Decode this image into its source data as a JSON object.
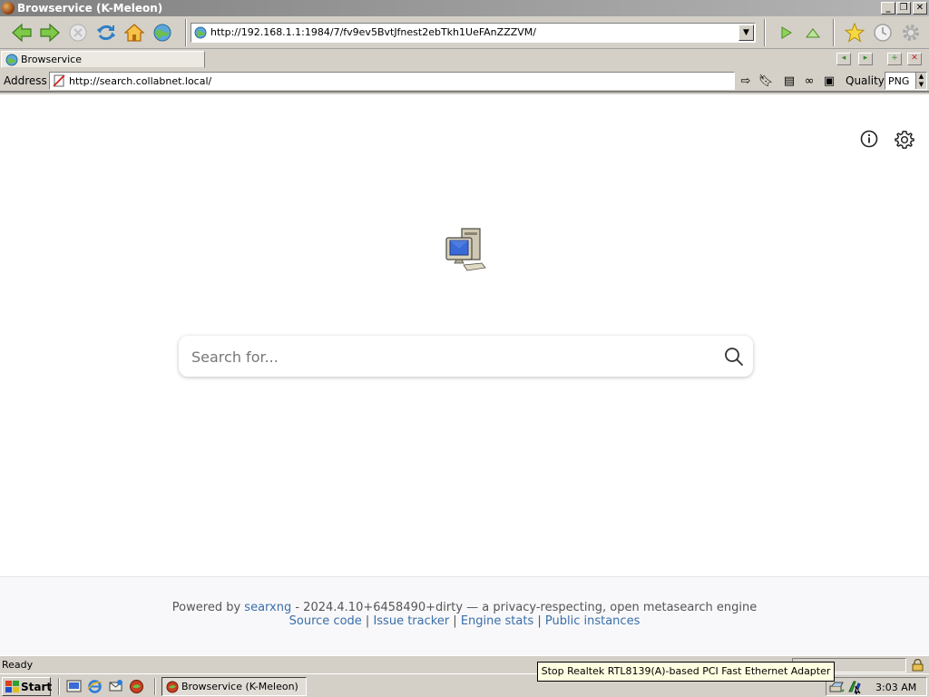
{
  "window": {
    "title": "Browservice (K-Meleon)"
  },
  "navbar": {
    "url": "http://192.168.1.1:1984/7/fv9ev5BvtJfnest2ebTkh1UeFAnZZZVM/",
    "buttons": [
      "back-icon",
      "forward-icon",
      "stop-icon",
      "reload-icon",
      "home-icon",
      "globe-icon"
    ]
  },
  "tabs": [
    {
      "label": "Browservice"
    }
  ],
  "address": {
    "label": "Address",
    "url": "http://search.collabnet.local/"
  },
  "quality": {
    "label": "Quality",
    "value": "PNG"
  },
  "page": {
    "search_placeholder": "Search for...",
    "footer": {
      "powered_by": "Powered by",
      "engine_link": "searxng",
      "version_text": " - 2024.4.10+6458490+dirty — a privacy-respecting, open metasearch engine",
      "links": [
        "Source code",
        "Issue tracker",
        "Engine stats",
        "Public instances"
      ],
      "separator": " | "
    }
  },
  "status": {
    "text": "Ready"
  },
  "taskbar": {
    "start_label": "Start",
    "task_label": "Browservice (K-Meleon)",
    "clock": "3:03 AM",
    "tooltip": "Stop Realtek RTL8139(A)-based PCI Fast Ethernet Adapter"
  },
  "colors": {
    "link": "#3a6ea8",
    "titlebar_from": "#808080",
    "titlebar_to": "#b5b5b5"
  }
}
